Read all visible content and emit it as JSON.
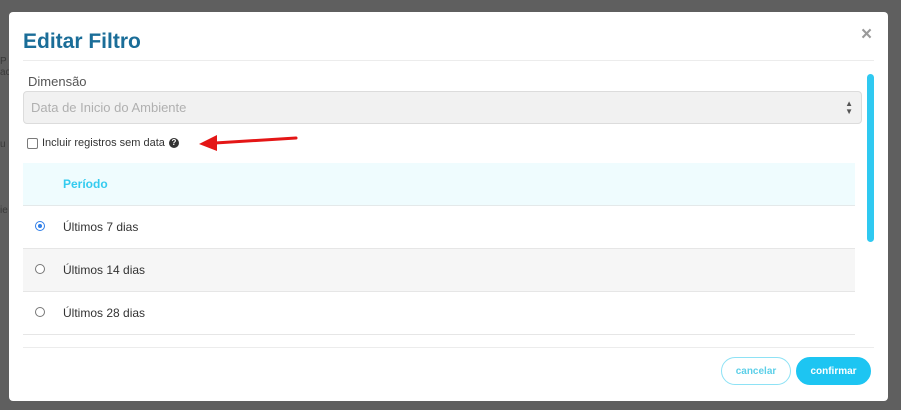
{
  "modal": {
    "title": "Editar Filtro",
    "close_glyph": "×"
  },
  "dimension": {
    "label": "Dimensão",
    "value": "Data de Inicio do Ambiente"
  },
  "include_without_date": {
    "label": "Incluir registros sem data",
    "checked": false,
    "help_glyph": "?"
  },
  "period": {
    "header": "Período",
    "options": [
      {
        "label": "Últimos 7 dias",
        "selected": true
      },
      {
        "label": "Últimos 14 dias",
        "selected": false
      },
      {
        "label": "Últimos 28 dias",
        "selected": false
      }
    ]
  },
  "footer": {
    "cancel_label": "cancelar",
    "confirm_label": "confirmar"
  },
  "colors": {
    "title": "#1a6d98",
    "accent": "#1dc5f2",
    "radio_selected": "#2f7ee8",
    "annotation_arrow": "#e41616"
  },
  "icons": {
    "close": "close-icon",
    "select_caret": "sort-arrows-icon",
    "help": "question-circle-icon",
    "annotation": "red-arrow-annotation"
  }
}
